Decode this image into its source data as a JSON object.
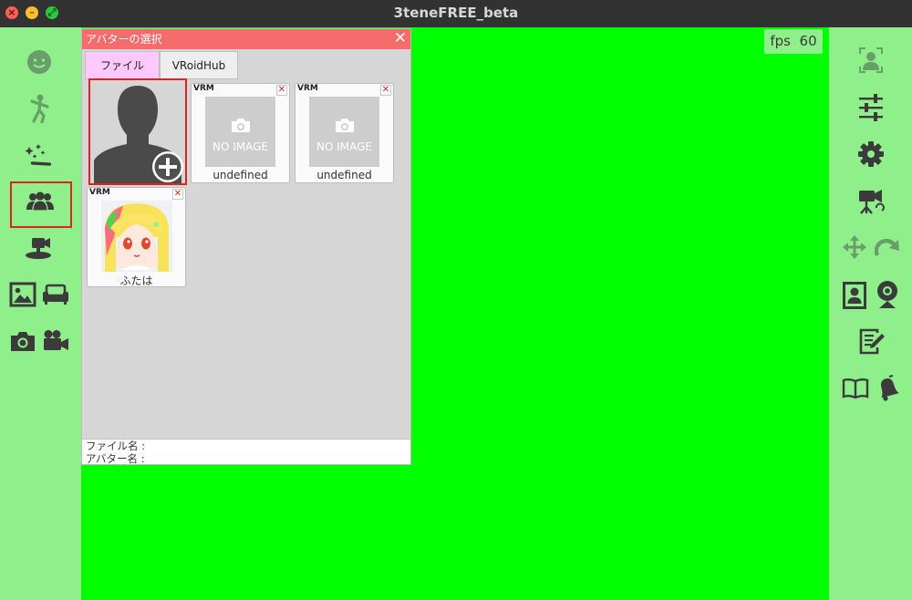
{
  "window": {
    "title": "3teneFREE_beta",
    "controls": {
      "close": "×",
      "minimize": "–",
      "zoom": "⤢"
    }
  },
  "fps": {
    "label": "fps",
    "value": "60"
  },
  "left_sidebar": {
    "items": [
      {
        "icon": "face-icon"
      },
      {
        "icon": "dance-pose-icon"
      },
      {
        "icon": "magic-wand-icon"
      },
      {
        "icon": "avatar-group-icon",
        "selected": true
      },
      {
        "icon": "camera-stand-icon"
      },
      {
        "icon": "image-icon"
      },
      {
        "icon": "sofa-icon"
      },
      {
        "icon": "photo-camera-icon"
      },
      {
        "icon": "video-camera-icon"
      }
    ]
  },
  "right_sidebar": {
    "items": [
      {
        "icon": "face-tracking-icon"
      },
      {
        "icon": "sliders-icon"
      },
      {
        "icon": "gear-icon"
      },
      {
        "icon": "movie-camera-icon"
      },
      {
        "icon": "move-arrows-icon"
      },
      {
        "icon": "rotate-icon"
      },
      {
        "icon": "portrait-icon"
      },
      {
        "icon": "webcam-icon"
      },
      {
        "icon": "note-edit-icon"
      },
      {
        "icon": "book-icon"
      },
      {
        "icon": "bell-icon"
      }
    ]
  },
  "panel": {
    "title": "アバターの選択",
    "close": "✕",
    "tabs": [
      {
        "label": "ファイル",
        "active": true
      },
      {
        "label": "VRoidHub",
        "active": false
      }
    ],
    "cards": [
      {
        "tag": "VRM",
        "image": "NO IMAGE",
        "name": "undefined",
        "remove": "✕"
      },
      {
        "tag": "VRM",
        "image": "NO IMAGE",
        "name": "undefined",
        "remove": "✕"
      },
      {
        "tag": "VRM",
        "image": "avatar-portrait",
        "name": "ふたは",
        "remove": "✕"
      }
    ],
    "info": {
      "file_label": "ファイル名 :",
      "avatar_label": "アバター名 :"
    }
  },
  "colors": {
    "sidebar": "#8ff08b",
    "canvas": "#00ff00",
    "panel_header": "#f66b6b",
    "active_tab": "#ffc8ff",
    "selection": "#e0231f",
    "icon_dark": "#3b3b3b",
    "icon_muted": "#6a9e68"
  }
}
